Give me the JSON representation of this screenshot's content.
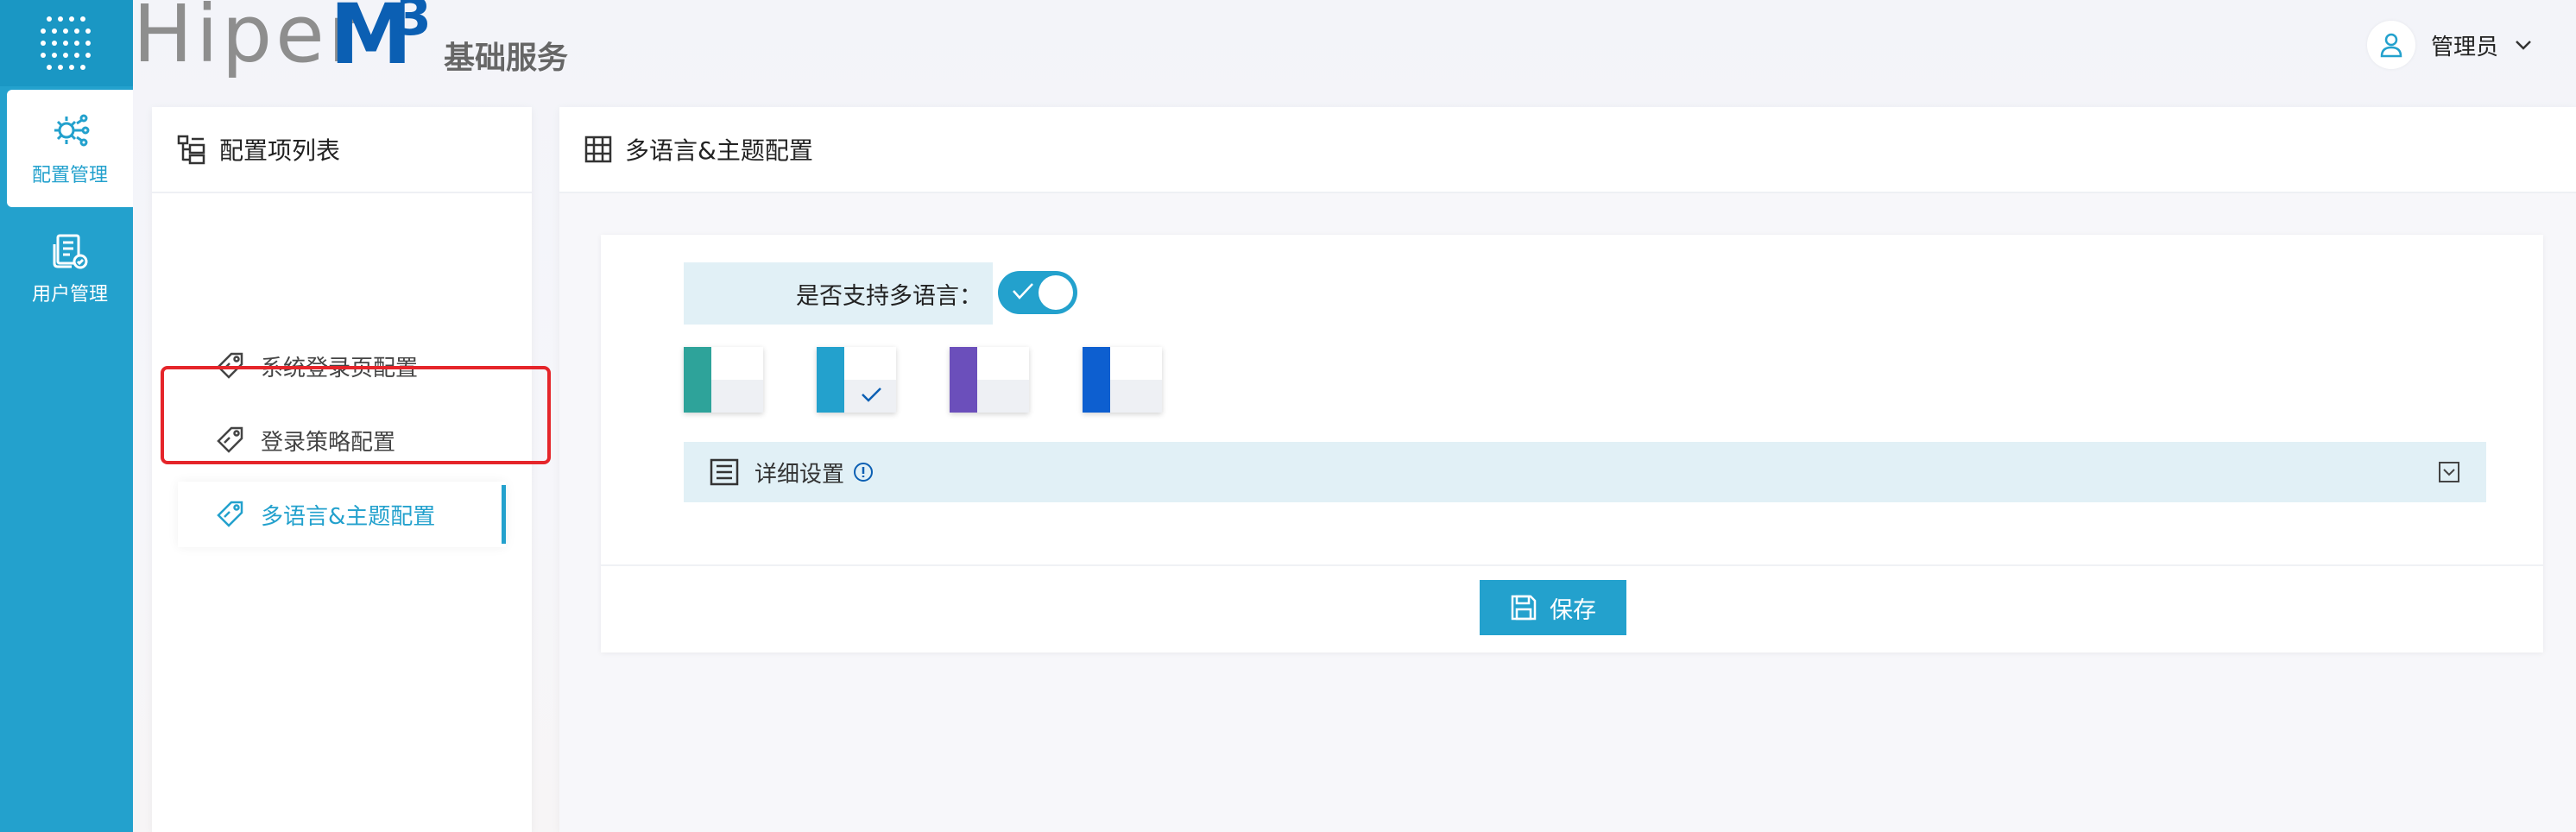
{
  "brand": {
    "logo_text": "HiperM3",
    "logo_main": "Hiper",
    "logo_m": "M",
    "logo_sup": "3",
    "subtitle": "基础服务",
    "accent": "#23a1cd",
    "logo_blue": "#0b5fb3"
  },
  "rail": {
    "items": [
      {
        "label": "配置管理",
        "icon": "gear-network-icon",
        "active": true
      },
      {
        "label": "用户管理",
        "icon": "user-document-icon",
        "active": false
      }
    ]
  },
  "user": {
    "name": "管理员",
    "icon": "user-icon"
  },
  "config_list": {
    "title": "配置项列表",
    "items": [
      {
        "label": "系统登录页配置",
        "icon": "tag-icon",
        "active": false
      },
      {
        "label": "登录策略配置",
        "icon": "tag-icon",
        "active": false
      },
      {
        "label": "多语言&主题配置",
        "icon": "tag-icon",
        "active": true
      }
    ]
  },
  "main": {
    "title": "多语言&主题配置",
    "multilang_label": "是否支持多语言：",
    "multilang_enabled": true,
    "themes": [
      {
        "color": "#2ea39a",
        "selected": false
      },
      {
        "color": "#23a1cd",
        "selected": true
      },
      {
        "color": "#6b4fbb",
        "selected": false
      },
      {
        "color": "#0d5fd0",
        "selected": false
      }
    ],
    "detail_label": "详细设置",
    "save_label": "保存"
  }
}
